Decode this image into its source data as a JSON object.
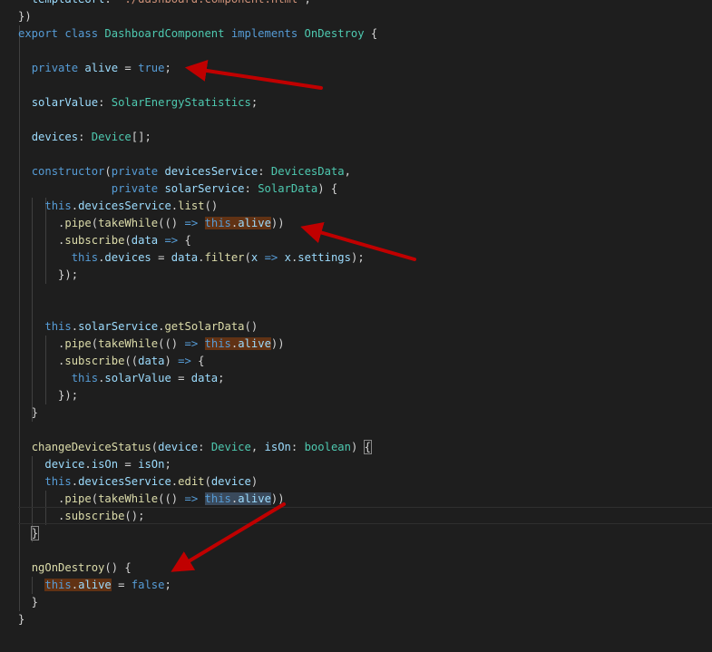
{
  "editor": {
    "lines": [
      [
        {
          "t": "  "
        },
        {
          "t": "templateUrl",
          "c": "va"
        },
        {
          "t": ": "
        },
        {
          "t": "'./dashboard.component.html'",
          "c": "st"
        },
        {
          "t": ","
        }
      ],
      [
        {
          "t": "})"
        }
      ],
      [
        {
          "t": "export",
          "c": "kw"
        },
        {
          "t": " "
        },
        {
          "t": "class",
          "c": "kw"
        },
        {
          "t": " "
        },
        {
          "t": "DashboardComponent",
          "c": "ty"
        },
        {
          "t": " "
        },
        {
          "t": "implements",
          "c": "kw"
        },
        {
          "t": " "
        },
        {
          "t": "OnDestroy",
          "c": "ty"
        },
        {
          "t": " {"
        }
      ],
      [],
      [
        {
          "t": "  "
        },
        {
          "t": "private",
          "c": "kw"
        },
        {
          "t": " "
        },
        {
          "t": "alive",
          "c": "va"
        },
        {
          "t": " = "
        },
        {
          "t": "true",
          "c": "kw"
        },
        {
          "t": ";"
        }
      ],
      [],
      [
        {
          "t": "  "
        },
        {
          "t": "solarValue",
          "c": "va"
        },
        {
          "t": ": "
        },
        {
          "t": "SolarEnergyStatistics",
          "c": "ty"
        },
        {
          "t": ";"
        }
      ],
      [],
      [
        {
          "t": "  "
        },
        {
          "t": "devices",
          "c": "va"
        },
        {
          "t": ": "
        },
        {
          "t": "Device",
          "c": "ty"
        },
        {
          "t": "[];"
        }
      ],
      [],
      [
        {
          "t": "  "
        },
        {
          "t": "constructor",
          "c": "kw"
        },
        {
          "t": "("
        },
        {
          "t": "private",
          "c": "kw"
        },
        {
          "t": " "
        },
        {
          "t": "devicesService",
          "c": "va"
        },
        {
          "t": ": "
        },
        {
          "t": "DevicesData",
          "c": "ty"
        },
        {
          "t": ","
        }
      ],
      [
        {
          "t": "              "
        },
        {
          "t": "private",
          "c": "kw"
        },
        {
          "t": " "
        },
        {
          "t": "solarService",
          "c": "va"
        },
        {
          "t": ": "
        },
        {
          "t": "SolarData",
          "c": "ty"
        },
        {
          "t": ") {"
        }
      ],
      [
        {
          "t": "    "
        },
        {
          "t": "this",
          "c": "kw"
        },
        {
          "t": "."
        },
        {
          "t": "devicesService",
          "c": "va"
        },
        {
          "t": "."
        },
        {
          "t": "list",
          "c": "fn"
        },
        {
          "t": "()"
        }
      ],
      [
        {
          "t": "      ."
        },
        {
          "t": "pipe",
          "c": "fn"
        },
        {
          "t": "("
        },
        {
          "t": "takeWhile",
          "c": "fn"
        },
        {
          "t": "(() "
        },
        {
          "t": "=>",
          "c": "kw"
        },
        {
          "t": " "
        },
        {
          "t": "this",
          "c": "kw hl"
        },
        {
          "t": ".",
          "c": "hl"
        },
        {
          "t": "alive",
          "c": "va hl"
        },
        {
          "t": "))"
        }
      ],
      [
        {
          "t": "      ."
        },
        {
          "t": "subscribe",
          "c": "fn"
        },
        {
          "t": "("
        },
        {
          "t": "data",
          "c": "va"
        },
        {
          "t": " "
        },
        {
          "t": "=>",
          "c": "kw"
        },
        {
          "t": " {"
        }
      ],
      [
        {
          "t": "        "
        },
        {
          "t": "this",
          "c": "kw"
        },
        {
          "t": "."
        },
        {
          "t": "devices",
          "c": "va"
        },
        {
          "t": " = "
        },
        {
          "t": "data",
          "c": "va"
        },
        {
          "t": "."
        },
        {
          "t": "filter",
          "c": "fn"
        },
        {
          "t": "("
        },
        {
          "t": "x",
          "c": "va"
        },
        {
          "t": " "
        },
        {
          "t": "=>",
          "c": "kw"
        },
        {
          "t": " "
        },
        {
          "t": "x",
          "c": "va"
        },
        {
          "t": "."
        },
        {
          "t": "settings",
          "c": "va"
        },
        {
          "t": ");"
        }
      ],
      [
        {
          "t": "      });"
        }
      ],
      [],
      [],
      [
        {
          "t": "    "
        },
        {
          "t": "this",
          "c": "kw"
        },
        {
          "t": "."
        },
        {
          "t": "solarService",
          "c": "va"
        },
        {
          "t": "."
        },
        {
          "t": "getSolarData",
          "c": "fn"
        },
        {
          "t": "()"
        }
      ],
      [
        {
          "t": "      ."
        },
        {
          "t": "pipe",
          "c": "fn"
        },
        {
          "t": "("
        },
        {
          "t": "takeWhile",
          "c": "fn"
        },
        {
          "t": "(() "
        },
        {
          "t": "=>",
          "c": "kw"
        },
        {
          "t": " "
        },
        {
          "t": "this",
          "c": "kw hl"
        },
        {
          "t": ".",
          "c": "hl"
        },
        {
          "t": "alive",
          "c": "va hl"
        },
        {
          "t": "))"
        }
      ],
      [
        {
          "t": "      ."
        },
        {
          "t": "subscribe",
          "c": "fn"
        },
        {
          "t": "(("
        },
        {
          "t": "data",
          "c": "va"
        },
        {
          "t": ") "
        },
        {
          "t": "=>",
          "c": "kw"
        },
        {
          "t": " {"
        }
      ],
      [
        {
          "t": "        "
        },
        {
          "t": "this",
          "c": "kw"
        },
        {
          "t": "."
        },
        {
          "t": "solarValue",
          "c": "va"
        },
        {
          "t": " = "
        },
        {
          "t": "data",
          "c": "va"
        },
        {
          "t": ";"
        }
      ],
      [
        {
          "t": "      });"
        }
      ],
      [
        {
          "t": "  }"
        }
      ],
      [],
      [
        {
          "t": "  "
        },
        {
          "t": "changeDeviceStatus",
          "c": "fn"
        },
        {
          "t": "("
        },
        {
          "t": "device",
          "c": "va"
        },
        {
          "t": ": "
        },
        {
          "t": "Device",
          "c": "ty"
        },
        {
          "t": ", "
        },
        {
          "t": "isOn",
          "c": "va"
        },
        {
          "t": ": "
        },
        {
          "t": "boolean",
          "c": "ty"
        },
        {
          "t": ") "
        },
        {
          "t": "{",
          "c": "bm"
        }
      ],
      [
        {
          "t": "    "
        },
        {
          "t": "device",
          "c": "va"
        },
        {
          "t": "."
        },
        {
          "t": "isOn",
          "c": "va"
        },
        {
          "t": " = "
        },
        {
          "t": "isOn",
          "c": "va"
        },
        {
          "t": ";"
        }
      ],
      [
        {
          "t": "    "
        },
        {
          "t": "this",
          "c": "kw"
        },
        {
          "t": "."
        },
        {
          "t": "devicesService",
          "c": "va"
        },
        {
          "t": "."
        },
        {
          "t": "edit",
          "c": "fn"
        },
        {
          "t": "("
        },
        {
          "t": "device",
          "c": "va"
        },
        {
          "t": ")"
        }
      ],
      [
        {
          "t": "      ."
        },
        {
          "t": "pipe",
          "c": "fn"
        },
        {
          "t": "("
        },
        {
          "t": "takeWhile",
          "c": "fn"
        },
        {
          "t": "(() "
        },
        {
          "t": "=>",
          "c": "kw"
        },
        {
          "t": " "
        },
        {
          "t": "this",
          "c": "kw hl2"
        },
        {
          "t": ".",
          "c": "hl2"
        },
        {
          "t": "alive",
          "c": "va hl2"
        },
        {
          "t": "))"
        }
      ],
      [
        {
          "t": "      ."
        },
        {
          "t": "subscribe",
          "c": "fn"
        },
        {
          "t": "();"
        }
      ],
      [
        {
          "t": "  "
        },
        {
          "t": "}",
          "c": "bm"
        }
      ],
      [],
      [
        {
          "t": "  "
        },
        {
          "t": "ngOnDestroy",
          "c": "fn"
        },
        {
          "t": "() {"
        }
      ],
      [
        {
          "t": "    "
        },
        {
          "t": "this",
          "c": "kw hl"
        },
        {
          "t": ".",
          "c": "hl"
        },
        {
          "t": "alive",
          "c": "va hl"
        },
        {
          "t": " = "
        },
        {
          "t": "false",
          "c": "kw"
        },
        {
          "t": ";"
        }
      ],
      [
        {
          "t": "  }"
        }
      ],
      [
        {
          "t": "}"
        }
      ]
    ]
  },
  "colors": {
    "background": "#1e1e1e",
    "keyword": "#569cd6",
    "type": "#4ec9b0",
    "function": "#dcdcaa",
    "variable": "#9cdcfe",
    "string": "#ce9178",
    "highlight": "#613214",
    "arrow": "#c00000"
  },
  "annotations": {
    "arrow_icon": "red-arrow-icon",
    "arrow_count": 4
  }
}
